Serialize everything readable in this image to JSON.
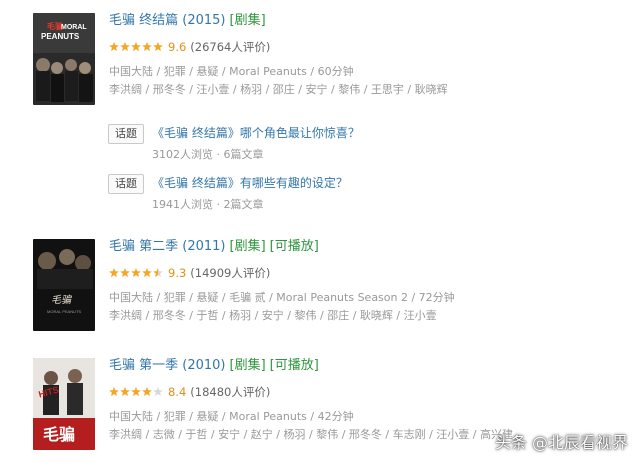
{
  "colors": {
    "link": "#3377aa",
    "tag": "#2e963d",
    "star": "#f5a623",
    "score": "#e09015",
    "meta": "#999999"
  },
  "items": [
    {
      "title": "毛骗 终结篇 (2015)",
      "tags": [
        "[剧集]"
      ],
      "stars": 5,
      "score": "9.6",
      "count": "(26764人评价)",
      "meta": "中国大陆 / 犯罪 / 悬疑 / Moral Peanuts / 60分钟",
      "cast": "李洪绸 / 邢冬冬 / 汪小壹 / 杨羽 / 邵庄 / 安宁 / 黎伟 / 王思宇 / 耿晓辉",
      "poster_text": "毛骗 MORAL PEANUTS"
    },
    {
      "title": "毛骗 第二季 (2011)",
      "tags": [
        "[剧集]",
        "[可播放]"
      ],
      "stars": 4.5,
      "score": "9.3",
      "count": "(14909人评价)",
      "meta": "中国大陆 / 犯罪 / 悬疑 / 毛骗 贰 / Moral Peanuts Season 2 / 72分钟",
      "cast": "李洪绸 / 邢冬冬 / 于哲 / 杨羽 / 安宁 / 黎伟 / 邵庄 / 耿晓辉 / 汪小壹",
      "poster_text": "毛骗"
    },
    {
      "title": "毛骗 第一季 (2010)",
      "tags": [
        "[剧集]",
        "[可播放]"
      ],
      "stars": 4,
      "score": "8.4",
      "count": "(18480人评价)",
      "meta": "中国大陆 / 犯罪 / 悬疑 / Moral Peanuts / 42分钟",
      "cast": "李洪绸 / 志微 / 于哲 / 安宁 / 赵宁 / 杨羽 / 黎伟 / 邢冬冬 / 车志刚 / 汪小壹 / 高兴建",
      "poster_text": "毛骗"
    }
  ],
  "topics": [
    {
      "badge": "话题",
      "title": "《毛骗    终结篇》哪个角色最让你惊喜？",
      "stats": "3102人浏览 · 6篇文章"
    },
    {
      "badge": "话题",
      "title": "《毛骗    终结篇》有哪些有趣的设定？",
      "stats": "1941人浏览 · 2篇文章"
    }
  ],
  "watermark": "头条 @北辰看视界"
}
